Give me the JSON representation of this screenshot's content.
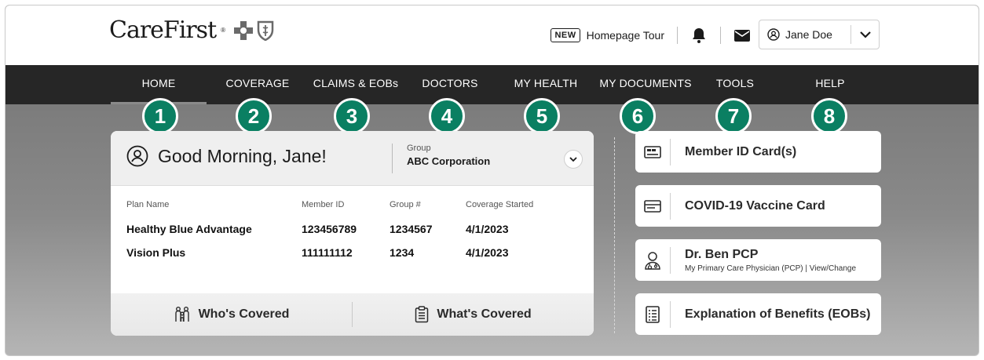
{
  "brand": {
    "name": "CareFirst",
    "tm": "®"
  },
  "header": {
    "tour_badge": "NEW",
    "tour_label": "Homepage Tour",
    "user_name": "Jane Doe",
    "icons": [
      "bell-icon",
      "mail-icon",
      "user-circle-icon",
      "chevron-down-icon"
    ]
  },
  "nav": {
    "items": [
      {
        "label": "HOME",
        "badge": "1",
        "active": true
      },
      {
        "label": "COVERAGE",
        "badge": "2"
      },
      {
        "label": "CLAIMS & EOBs",
        "badge": "3"
      },
      {
        "label": "DOCTORS",
        "badge": "4"
      },
      {
        "label": "MY HEALTH",
        "badge": "5"
      },
      {
        "label": "MY DOCUMENTS",
        "badge": "6"
      },
      {
        "label": "TOOLS",
        "badge": "7"
      },
      {
        "label": "HELP",
        "badge": "8"
      }
    ]
  },
  "card": {
    "greeting": "Good Morning, Jane!",
    "group_label": "Group",
    "group_value": "ABC Corporation",
    "columns": [
      "Plan Name",
      "Member ID",
      "Group #",
      "Coverage Started"
    ],
    "rows": [
      [
        "Healthy Blue Advantage",
        "123456789",
        "1234567",
        "4/1/2023"
      ],
      [
        "Vision Plus",
        "111111112",
        "1234",
        "4/1/2023"
      ]
    ],
    "footer": {
      "whos_covered": "Who's Covered",
      "whats_covered": "What's Covered"
    }
  },
  "tiles": [
    {
      "label": "Member ID Card(s)",
      "icon": "id-card-icon"
    },
    {
      "label": "COVID-19 Vaccine Card",
      "icon": "card-icon"
    },
    {
      "label": "Dr. Ben PCP",
      "icon": "doctor-icon",
      "sub_text": "My Primary Care Physician (PCP) | ",
      "sub_link": "View/Change"
    },
    {
      "label": "Explanation of Benefits (EOBs)",
      "icon": "document-list-icon"
    }
  ],
  "colors": {
    "nav_bg": "#262626",
    "badge": "#0a7f62"
  }
}
